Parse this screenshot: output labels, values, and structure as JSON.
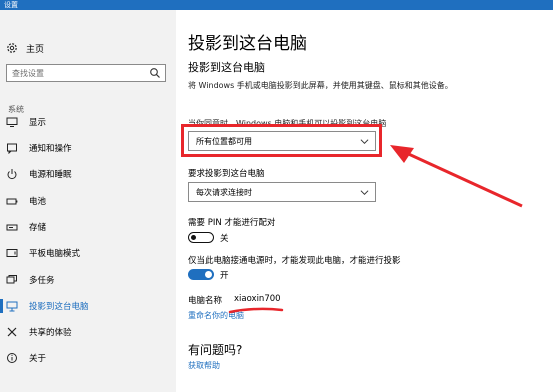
{
  "window": {
    "title": "设置"
  },
  "sidebar": {
    "home_label": "主页",
    "search_placeholder": "查找设置",
    "section_label": "系统",
    "items": [
      {
        "label": "显示",
        "icon": "monitor-icon"
      },
      {
        "label": "通知和操作",
        "icon": "notification-icon"
      },
      {
        "label": "电源和睡眠",
        "icon": "power-icon"
      },
      {
        "label": "电池",
        "icon": "battery-icon"
      },
      {
        "label": "存储",
        "icon": "storage-icon"
      },
      {
        "label": "平板电脑模式",
        "icon": "tablet-icon"
      },
      {
        "label": "多任务",
        "icon": "multitask-icon"
      },
      {
        "label": "投影到这台电脑",
        "icon": "project-icon",
        "active": true
      },
      {
        "label": "共享的体验",
        "icon": "share-icon"
      },
      {
        "label": "关于",
        "icon": "info-icon"
      }
    ]
  },
  "main": {
    "title": "投影到这台电脑",
    "subtitle": "投影到这台电脑",
    "description": "将 Windows 手机或电脑投影到此屏幕，并使用其键盘、鼠标和其他设备。",
    "availability_label": "当你同意时，Windows 电脑和手机可以投影到这台电脑",
    "availability_value": "所有位置都可用",
    "request_label": "要求投影到这台电脑",
    "request_value": "每次请求连接时",
    "pin_label": "需要 PIN 才能进行配对",
    "pin_state": "关",
    "power_label": "仅当此电脑接通电源时，才能发现此电脑，才能进行投影",
    "power_state": "开",
    "pc_name_label": "电脑名称",
    "pc_name_value": "xiaoxin700",
    "rename_link": "重命名你的电脑",
    "help_title": "有问题吗?",
    "help_link": "获取帮助"
  },
  "colors": {
    "accent": "#1f6fbf",
    "annotation": "#e8262b",
    "sidebar_bg": "#f2f2f2"
  }
}
